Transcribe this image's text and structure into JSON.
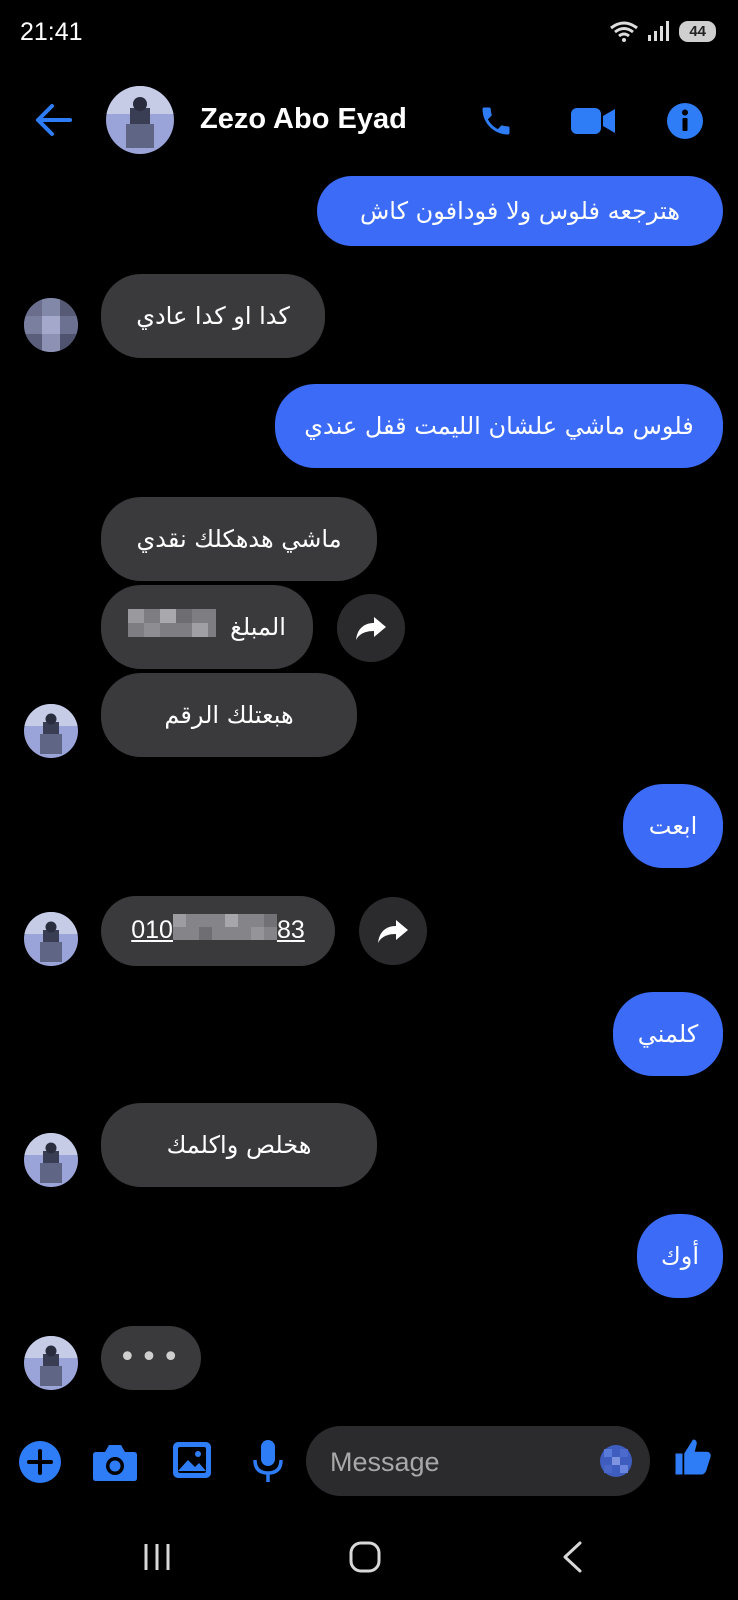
{
  "status_bar": {
    "time": "21:41",
    "battery": "44"
  },
  "header": {
    "contact_name": "Zezo Abo Eyad"
  },
  "messages": [
    {
      "direction": "outgoing",
      "text": "هترجعه فلوس ولا فودافون كاش"
    },
    {
      "direction": "incoming",
      "text": "كدا او كدا عادي"
    },
    {
      "direction": "outgoing",
      "text": "فلوس ماشي علشان الليمت قفل عندي"
    },
    {
      "direction": "incoming",
      "text": "ماشي هدهكلك نقدي"
    },
    {
      "direction": "incoming",
      "text": "المبلغ"
    },
    {
      "direction": "incoming",
      "text": "هبعتلك الرقم"
    },
    {
      "direction": "outgoing",
      "text": "ابعت"
    },
    {
      "direction": "incoming",
      "phone_prefix": "010",
      "phone_suffix": "83"
    },
    {
      "direction": "outgoing",
      "text": "كلمني"
    },
    {
      "direction": "incoming",
      "text": "هخلص واكلمك"
    },
    {
      "direction": "outgoing",
      "text": "أوك"
    }
  ],
  "typing_indicator": "•••",
  "composer": {
    "placeholder": "Message"
  },
  "colors": {
    "outgoing_bubble": "#3b6bf7",
    "incoming_bubble": "#3a3a3c",
    "accent": "#2f7df6",
    "background": "#000000"
  },
  "icons": [
    "back-arrow-icon",
    "phone-icon",
    "video-icon",
    "info-icon",
    "share-icon",
    "plus-icon",
    "camera-icon",
    "gallery-icon",
    "mic-icon",
    "emoji-icon",
    "like-icon",
    "recents-icon",
    "home-icon",
    "back-nav-icon"
  ]
}
